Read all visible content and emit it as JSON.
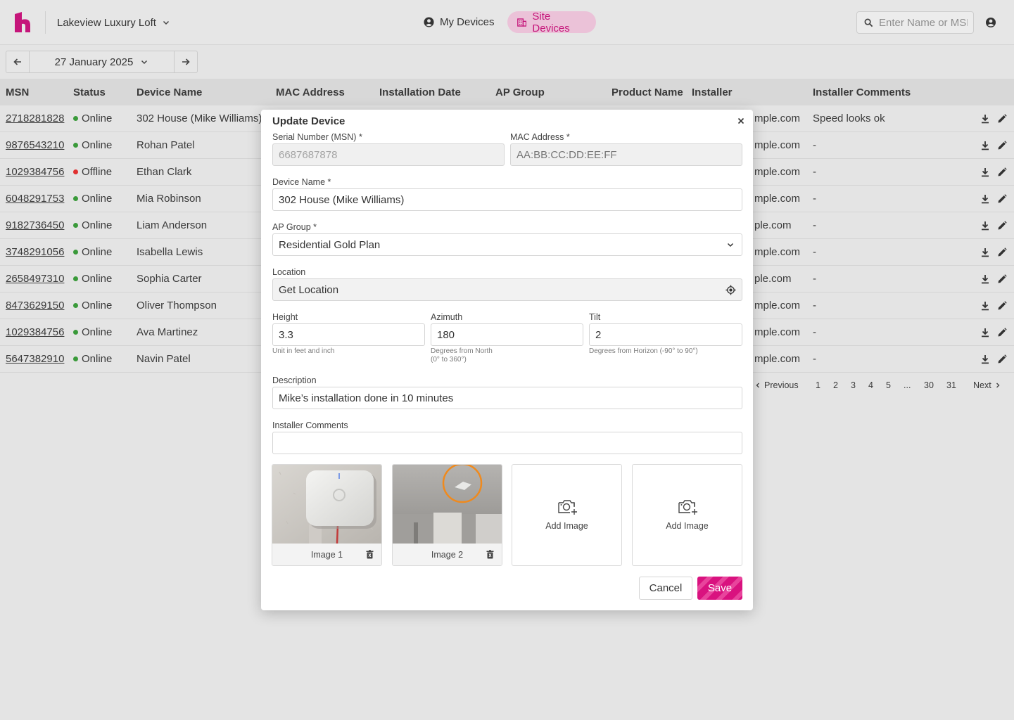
{
  "header": {
    "site_name": "Lakeview Luxury Loft",
    "tabs": [
      {
        "label": "My Devices",
        "icon": "account-circle-icon"
      },
      {
        "label": "Site Devices",
        "icon": "building-icon",
        "active": true
      }
    ],
    "search_placeholder": "Enter Name or MSN",
    "accent_color": "#c5157a"
  },
  "date_nav": {
    "date": "27 January 2025"
  },
  "table": {
    "columns": [
      "MSN",
      "Status",
      "Device Name",
      "MAC Address",
      "Installation Date",
      "AP Group",
      "Product Name",
      "Installer",
      "Installer Comments"
    ],
    "rows": [
      {
        "msn": "2718281828",
        "status": "Online",
        "device": "302 House (Mike Williams)",
        "installer": "mple.com",
        "comments": "Speed looks ok"
      },
      {
        "msn": "9876543210",
        "status": "Online",
        "device": "Rohan Patel",
        "installer": "mple.com",
        "comments": "-"
      },
      {
        "msn": "1029384756",
        "status": "Offline",
        "device": "Ethan Clark",
        "installer": "mple.com",
        "comments": "-"
      },
      {
        "msn": "6048291753",
        "status": "Online",
        "device": "Mia Robinson",
        "installer": "mple.com",
        "comments": "-"
      },
      {
        "msn": "9182736450",
        "status": "Online",
        "device": "Liam Anderson",
        "installer": "ple.com",
        "comments": "-"
      },
      {
        "msn": "3748291056",
        "status": "Online",
        "device": "Isabella Lewis",
        "installer": "mple.com",
        "comments": "-"
      },
      {
        "msn": "2658497310",
        "status": "Online",
        "device": "Sophia Carter",
        "installer": "ple.com",
        "comments": "-"
      },
      {
        "msn": "8473629150",
        "status": "Online",
        "device": "Oliver Thompson",
        "installer": "mple.com",
        "comments": "-"
      },
      {
        "msn": "1029384756",
        "status": "Online",
        "device": "Ava Martinez",
        "installer": "mple.com",
        "comments": "-"
      },
      {
        "msn": "5647382910",
        "status": "Online",
        "device": "Navin Patel",
        "installer": "mple.com",
        "comments": "-"
      }
    ],
    "status_colors": {
      "Online": "#3a9a3a",
      "Offline": "#e03030"
    }
  },
  "pagination": {
    "previous": "Previous",
    "pages": [
      "1",
      "2",
      "3",
      "4",
      "5",
      "...",
      "30",
      "31"
    ],
    "next": "Next"
  },
  "modal": {
    "title": "Update Device",
    "msn": {
      "label": "Serial Number (MSN)",
      "required": "*",
      "value": "6687687878"
    },
    "mac": {
      "label": "MAC Address",
      "required": "*",
      "placeholder": "AA:BB:CC:DD:EE:FF"
    },
    "device_name": {
      "label": "Device Name",
      "required": "*",
      "value": "302 House (Mike Williams)"
    },
    "ap_group": {
      "label": "AP Group",
      "required": "*",
      "value": "Residential Gold Plan"
    },
    "location": {
      "label": "Location",
      "value": "Get Location"
    },
    "height": {
      "label": "Height",
      "value": "3.3",
      "hint": "Unit in feet and inch"
    },
    "azimuth": {
      "label": "Azimuth",
      "value": "180",
      "hint1": "Degrees from North",
      "hint2": "(0° to 360°)"
    },
    "tilt": {
      "label": "Tilt",
      "value": "2",
      "hint": "Degrees from Horizon (-90° to 90°)"
    },
    "description": {
      "label": "Description",
      "value": "Mike’s installation done in 10 minutes"
    },
    "installer_comments": {
      "label": "Installer Comments",
      "value": ""
    },
    "images": [
      {
        "label": "Image 1"
      },
      {
        "label": "Image 2"
      }
    ],
    "add_image_label": "Add Image",
    "cancel_label": "Cancel",
    "save_label": "Save"
  }
}
